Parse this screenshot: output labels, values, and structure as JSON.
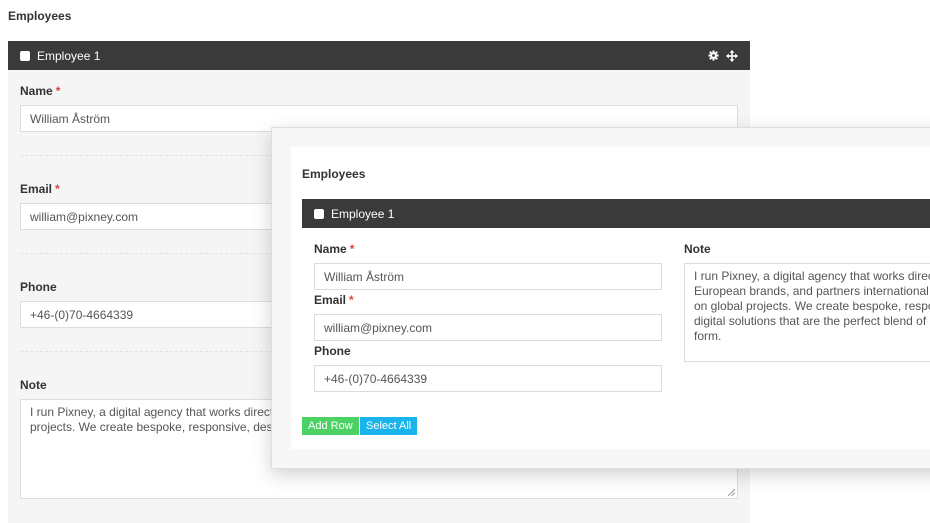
{
  "background": {
    "title": "Employees",
    "row_title": "Employee 1",
    "icons": [
      "gear-icon",
      "move-icon"
    ],
    "fields": {
      "name": {
        "label": "Name",
        "required_mark": "*",
        "value": "William Åström"
      },
      "email": {
        "label": "Email",
        "required_mark": "*",
        "value": "william@pixney.com"
      },
      "phone": {
        "label": "Phone",
        "value": "+46-(0)70-4664339"
      },
      "note": {
        "label": "Note",
        "line1": "I run Pixney, a digital agency that works directly w",
        "line2": "projects. We create bespoke, responsive, design-"
      }
    }
  },
  "popup": {
    "title": "Employees",
    "row_title": "Employee 1",
    "fields": {
      "name": {
        "label": "Name",
        "required_mark": "*",
        "value": "William Åström"
      },
      "email": {
        "label": "Email",
        "required_mark": "*",
        "value": "william@pixney.com"
      },
      "phone": {
        "label": "Phone",
        "value": "+46-(0)70-4664339"
      },
      "note": {
        "label": "Note",
        "lines": [
          "I run Pixney, a digital agency that works direc",
          "European brands, and partners international c",
          "on global projects. We create bespoke, respo",
          "digital solutions that are the perfect blend of",
          "form."
        ]
      }
    },
    "buttons": {
      "add_row": "Add Row",
      "select_all": "Select All"
    }
  },
  "colors": {
    "bar": "#3a3a3a",
    "required": "#e0433f",
    "add_row": "#4cd264",
    "select_all": "#19b4eb"
  }
}
